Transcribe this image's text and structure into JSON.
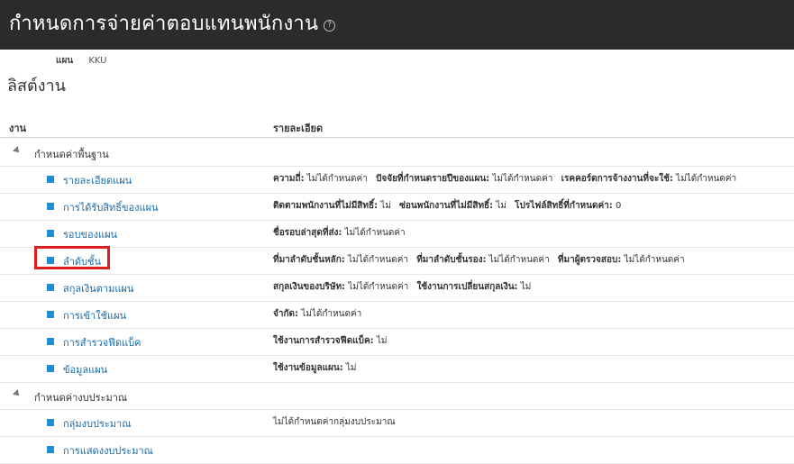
{
  "header": {
    "title": "กำหนดการจ่ายค่าตอบแทนพนักงาน",
    "help_icon": "?"
  },
  "plan": {
    "label": "แผน",
    "value": "KKU"
  },
  "section_title": "ลิสต์งาน",
  "columns": {
    "task": "งาน",
    "detail": "รายละเอียด"
  },
  "groups": [
    {
      "label": "กำหนดค่าพื้นฐาน",
      "tasks": [
        {
          "label": "รายละเอียดแผน",
          "details": [
            {
              "k": "ความถี่:",
              "v": "ไม่ได้กำหนดค่า"
            },
            {
              "k": "ปัจจัยที่กำหนดรายปีของแผน:",
              "v": "ไม่ได้กำหนดค่า"
            },
            {
              "k": "เรคคอร์ดการจ้างงานที่จะใช้:",
              "v": "ไม่ได้กำหนดค่า"
            }
          ]
        },
        {
          "label": "การได้รับสิทธิ์ของแผน",
          "details": [
            {
              "k": "ติดตามพนักงานที่ไม่มีสิทธิ์:",
              "v": "ไม่"
            },
            {
              "k": "ซ่อนพนักงานที่ไม่มีสิทธิ์:",
              "v": "ไม่"
            },
            {
              "k": "โปรไฟล์สิทธิ์ที่กำหนดค่า:",
              "v": "0"
            }
          ]
        },
        {
          "label": "รอบของแผน",
          "details": [
            {
              "k": "ชื่อรอบล่าสุดที่ส่ง:",
              "v": "ไม่ได้กำหนดค่า"
            }
          ]
        },
        {
          "label": "ลำดับชั้น",
          "details": [
            {
              "k": "ที่มาลำดับชั้นหลัก:",
              "v": "ไม่ได้กำหนดค่า"
            },
            {
              "k": "ที่มาลำดับชั้นรอง:",
              "v": "ไม่ได้กำหนดค่า"
            },
            {
              "k": "ที่มาผู้ตรวจสอบ:",
              "v": "ไม่ได้กำหนดค่า"
            }
          ]
        },
        {
          "label": "สกุลเงินตามแผน",
          "details": [
            {
              "k": "สกุลเงินของบริษัท:",
              "v": "ไม่ได้กำหนดค่า"
            },
            {
              "k": "ใช้งานการเปลี่ยนสกุลเงิน:",
              "v": "ไม่"
            }
          ]
        },
        {
          "label": "การเข้าใช้แผน",
          "details": [
            {
              "k": "จำกัด:",
              "v": "ไม่ได้กำหนดค่า"
            }
          ]
        },
        {
          "label": "การสำรวจฟีดแบ็ค",
          "details": [
            {
              "k": "ใช้งานการสำรวจฟีดแบ็ค:",
              "v": "ไม่"
            }
          ]
        },
        {
          "label": "ข้อมูลแผน",
          "details": [
            {
              "k": "ใช้งานข้อมูลแผน:",
              "v": "ไม่"
            }
          ]
        }
      ]
    },
    {
      "label": "กำหนดค่างบประมาณ",
      "tasks": [
        {
          "label": "กลุ่มงบประมาณ",
          "details": [
            {
              "k": "",
              "v": "ไม่ได้กำหนดค่ากลุ่มงบประมาณ"
            }
          ]
        },
        {
          "label": "การแสดงงบประมาณ",
          "details": []
        }
      ]
    }
  ],
  "colors": {
    "link": "#1a6aa6",
    "bullet": "#1f8dd6",
    "topbar": "#2b2b2b",
    "highlight": "#e02020"
  }
}
